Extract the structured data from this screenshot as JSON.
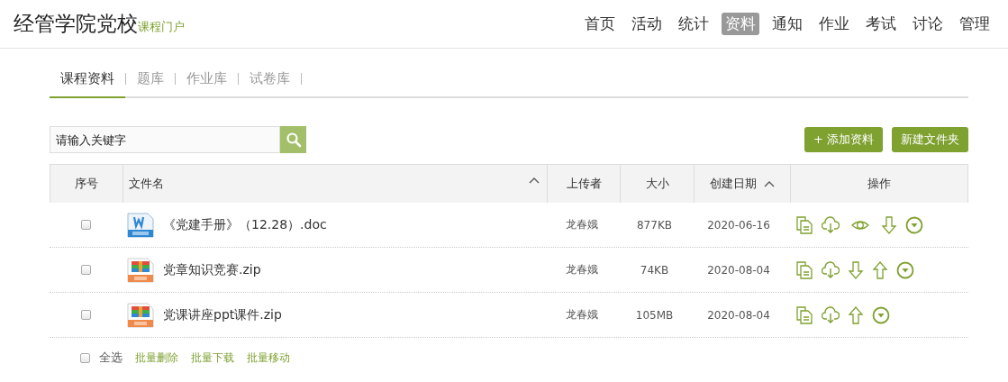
{
  "header": {
    "title": "经管学院党校",
    "subtitle": "课程门户",
    "nav": [
      {
        "label": "首页",
        "selected": false
      },
      {
        "label": "活动",
        "selected": false
      },
      {
        "label": "统计",
        "selected": false
      },
      {
        "label": "资料",
        "selected": true
      },
      {
        "label": "通知",
        "selected": false
      },
      {
        "label": "作业",
        "selected": false
      },
      {
        "label": "考试",
        "selected": false
      },
      {
        "label": "讨论",
        "selected": false
      },
      {
        "label": "管理",
        "selected": false
      }
    ]
  },
  "subtabs": [
    {
      "label": "课程资料",
      "selected": true
    },
    {
      "label": "题库",
      "selected": false
    },
    {
      "label": "作业库",
      "selected": false
    },
    {
      "label": "试卷库",
      "selected": false
    }
  ],
  "search": {
    "placeholder": "请输入关键字"
  },
  "buttons": [
    {
      "icon": "+",
      "label": "添加资料"
    },
    {
      "label": "新建文件夹"
    }
  ],
  "table": {
    "columns": [
      {
        "label": "序号",
        "sortable": false
      },
      {
        "label": "文件名",
        "sortable": true
      },
      {
        "label": "上传者",
        "sortable": false
      },
      {
        "label": "大小",
        "sortable": false
      },
      {
        "label": "创建日期",
        "sortable": true
      },
      {
        "label": "操作",
        "sortable": false
      }
    ],
    "rows": [
      {
        "checked": false,
        "kind": "word",
        "name": "《党建手册》（12.28）.doc",
        "uploader": "龙春娥",
        "size": "877KB",
        "date": "2020-06-16",
        "actions": [
          {
            "kind": "copy"
          },
          {
            "kind": "cloud"
          },
          {
            "kind": "eye"
          },
          {
            "kind": "down"
          },
          {
            "kind": "more"
          }
        ]
      },
      {
        "checked": false,
        "kind": "rar",
        "name": "党章知识竞赛.zip",
        "uploader": "龙春娥",
        "size": "74KB",
        "date": "2020-08-04",
        "actions": [
          {
            "kind": "copy"
          },
          {
            "kind": "cloud"
          },
          {
            "kind": "down"
          },
          {
            "kind": "up"
          },
          {
            "kind": "more"
          }
        ]
      },
      {
        "checked": false,
        "kind": "rar",
        "name": "党课讲座ppt课件.zip",
        "uploader": "龙春娥",
        "size": "105MB",
        "date": "2020-08-04",
        "actions": [
          {
            "kind": "copy"
          },
          {
            "kind": "cloud"
          },
          {
            "kind": "up"
          },
          {
            "kind": "more"
          }
        ]
      }
    ]
  },
  "footer": {
    "select_all": {
      "label": "全选",
      "checked": false
    },
    "links": [
      "批量删除",
      "批量下载",
      "批量移动"
    ]
  }
}
